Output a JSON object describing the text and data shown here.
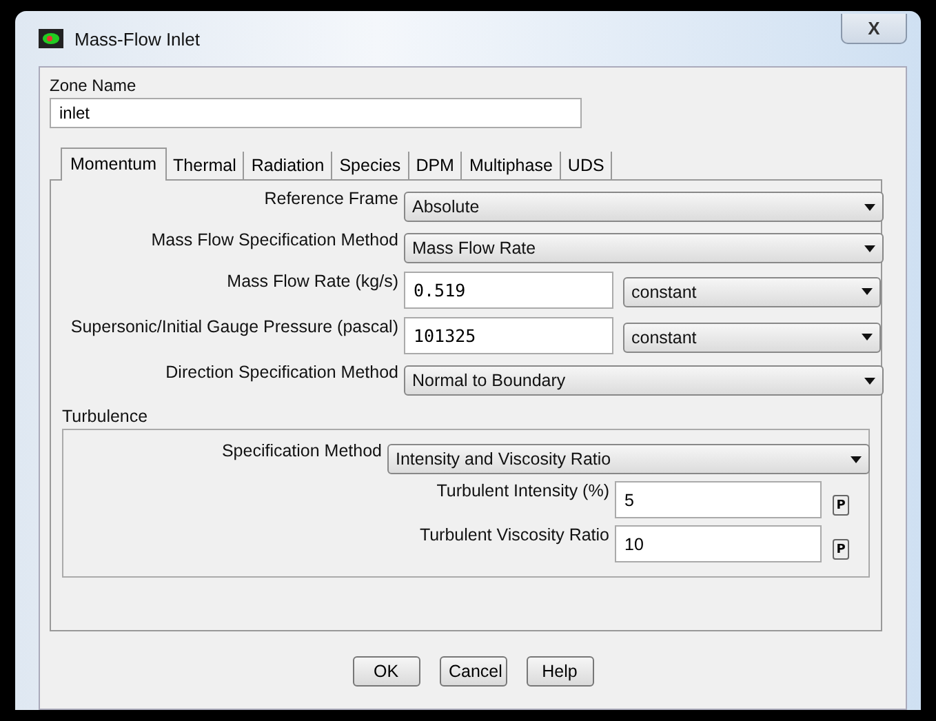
{
  "window": {
    "title": "Mass-Flow Inlet",
    "close": "X"
  },
  "zone_name": {
    "label": "Zone Name",
    "value": "inlet"
  },
  "tabs": [
    {
      "label": "Momentum",
      "selected": true
    },
    {
      "label": "Thermal",
      "selected": false
    },
    {
      "label": "Radiation",
      "selected": false
    },
    {
      "label": "Species",
      "selected": false
    },
    {
      "label": "DPM",
      "selected": false
    },
    {
      "label": "Multiphase",
      "selected": false
    },
    {
      "label": "UDS",
      "selected": false
    }
  ],
  "rows": [
    {
      "kind": "dropdown",
      "label": "Reference Frame",
      "value": "Absolute"
    },
    {
      "kind": "dropdown",
      "label": "Mass Flow Specification Method",
      "value": "Mass Flow Rate"
    },
    {
      "kind": "field_dropdown",
      "label": "Mass Flow Rate (kg/s)",
      "value": "0.519",
      "option": "constant"
    },
    {
      "kind": "field_dropdown",
      "label": "Supersonic/Initial Gauge Pressure (pascal)",
      "value": "101325",
      "option": "constant"
    },
    {
      "kind": "dropdown",
      "label": "Direction Specification Method",
      "value": "Normal to Boundary"
    }
  ],
  "turbulence": {
    "title": "Turbulence",
    "method": {
      "label": "Specification Method",
      "value": "Intensity and Viscosity Ratio"
    },
    "fields": [
      {
        "label": "Turbulent Intensity (%)",
        "value": "5",
        "param": "P"
      },
      {
        "label": "Turbulent Viscosity Ratio",
        "value": "10",
        "param": "P"
      }
    ]
  },
  "buttons": [
    "OK",
    "Cancel",
    "Help"
  ]
}
